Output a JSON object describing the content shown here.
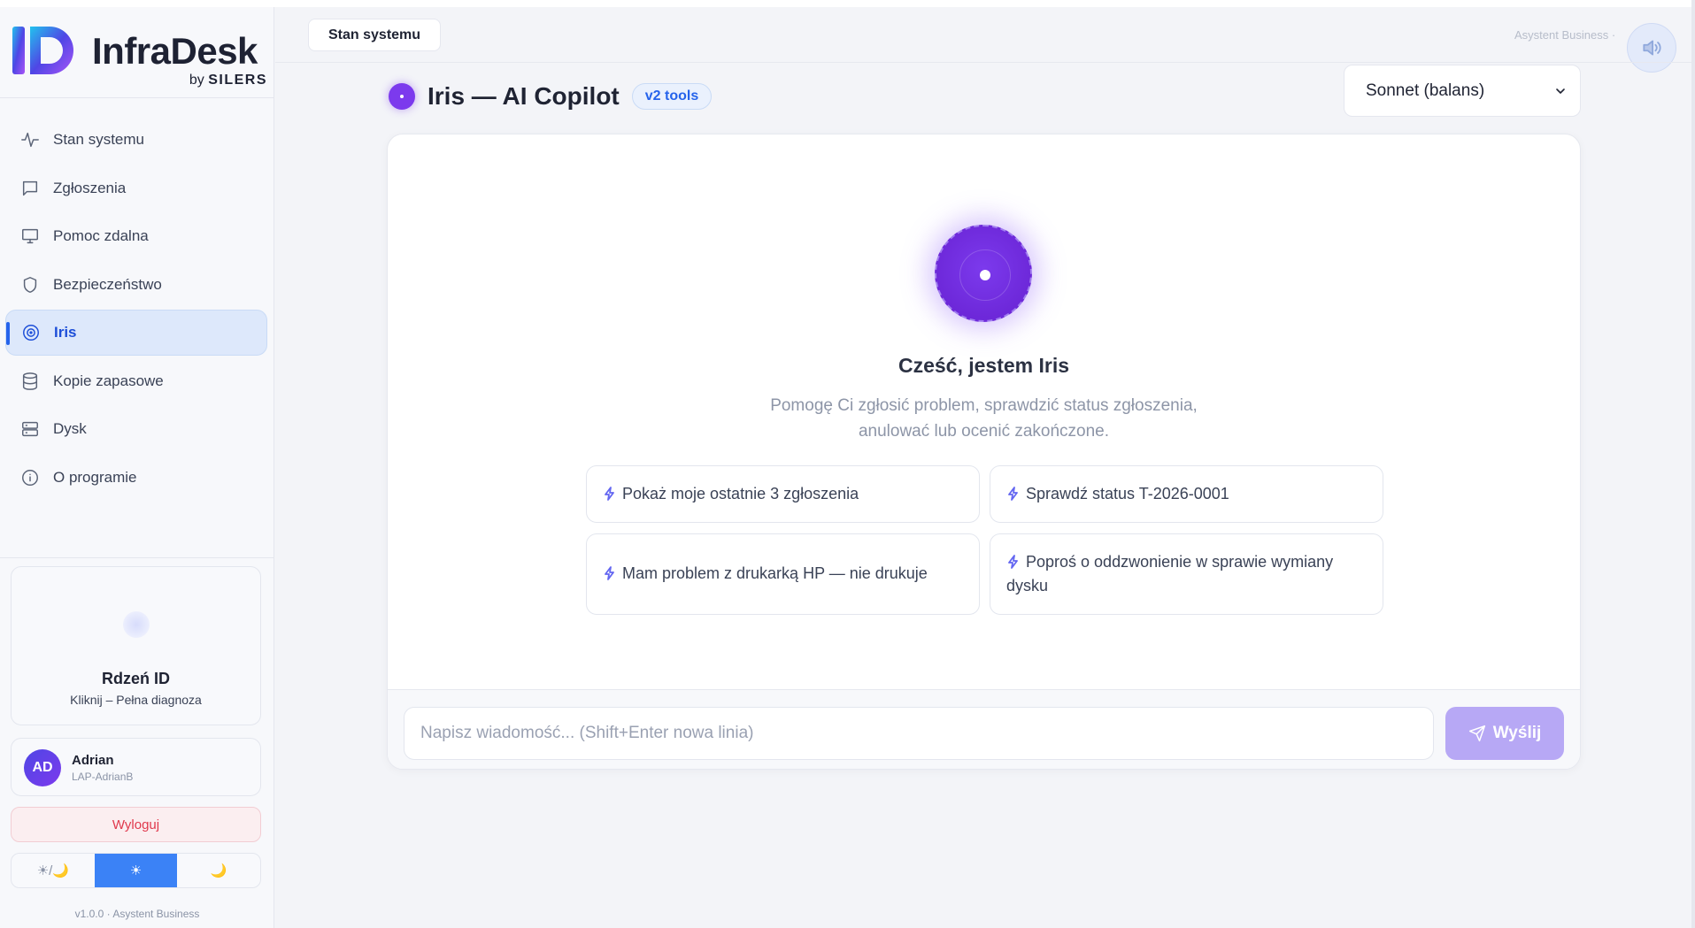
{
  "brand": {
    "title": "InfraDesk",
    "by": "by",
    "company": "SILERS"
  },
  "sidebar": {
    "items": [
      {
        "label": "Stan systemu",
        "icon": "activity-icon"
      },
      {
        "label": "Zgłoszenia",
        "icon": "message-icon"
      },
      {
        "label": "Pomoc zdalna",
        "icon": "monitor-icon"
      },
      {
        "label": "Bezpieczeństwo",
        "icon": "shield-icon"
      },
      {
        "label": "Iris",
        "icon": "target-icon",
        "active": true
      },
      {
        "label": "Kopie zapasowe",
        "icon": "database-icon"
      },
      {
        "label": "Dysk",
        "icon": "server-icon"
      },
      {
        "label": "O programie",
        "icon": "info-icon"
      }
    ],
    "core": {
      "title": "Rdzeń ID",
      "subtitle": "Kliknij – Pełna diagnoza"
    },
    "user": {
      "initials": "AD",
      "name": "Adrian",
      "host": "LAP-AdrianB"
    },
    "logout_label": "Wyloguj",
    "theme": {
      "auto": "☀/🌙",
      "light": "☀",
      "dark": "🌙",
      "selected": "light"
    },
    "version": "v1.0.0 · Asystent Business"
  },
  "topbar": {
    "tab_label": "Stan systemu",
    "right_text": "Asystent Business ·",
    "sound_icon": "speaker-icon"
  },
  "page": {
    "title": "Iris — AI Copilot",
    "badge": "v2 tools",
    "model_selected": "Sonnet (balans)"
  },
  "chat": {
    "greeting": "Cześć, jestem Iris",
    "intro_line1": "Pomogę Ci zgłosić problem, sprawdzić status zgłoszenia,",
    "intro_line2": "anulować lub ocenić zakończone.",
    "suggestions": [
      "Pokaż moje ostatnie 3 zgłoszenia",
      "Sprawdź status T-2026-0001",
      "Mam problem z drukarką HP — nie drukuje",
      "Poproś o oddzwonienie w sprawie wymiany dysku"
    ],
    "input_placeholder": "Napisz wiadomość... (Shift+Enter nowa linia)",
    "send_label": "Wyślij"
  },
  "colors": {
    "accent": "#2563eb",
    "iris": "#7c3aed",
    "send": "#b7a8f5",
    "logout": "#e0394d"
  }
}
